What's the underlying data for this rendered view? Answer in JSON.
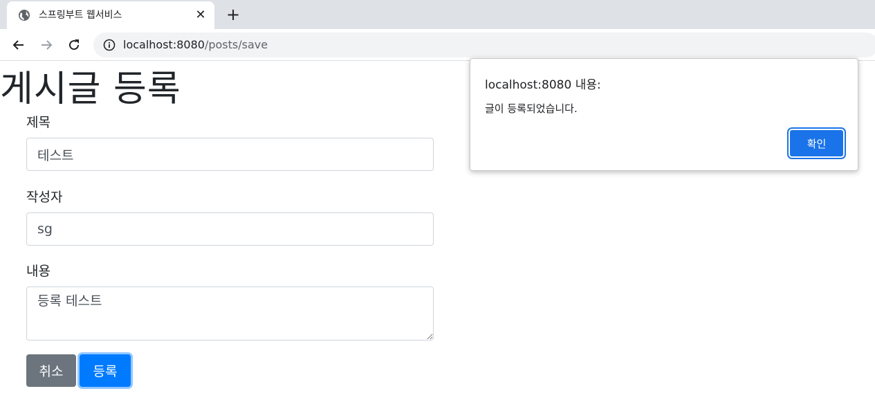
{
  "browser": {
    "tab": {
      "title": "스프링부트 웹서비스",
      "close_glyph": "✕",
      "favicon": "globe-icon"
    },
    "new_tab_glyph": "+",
    "address_bar": {
      "host": "localhost:8080",
      "path": "/posts/save"
    }
  },
  "page": {
    "heading": "게시글 등록",
    "form": {
      "title_label": "제목",
      "title_value": "테스트",
      "author_label": "작성자",
      "author_value": "sg",
      "content_label": "내용",
      "content_value": "등록 테스트",
      "cancel_label": "취소",
      "submit_label": "등록"
    }
  },
  "dialog": {
    "title": "localhost:8080 내용:",
    "message": "글이 등록되었습니다.",
    "ok_label": "확인"
  },
  "colors": {
    "primary": "#007bff",
    "secondary": "#6c757d",
    "dialog_button": "#1a73e8"
  }
}
